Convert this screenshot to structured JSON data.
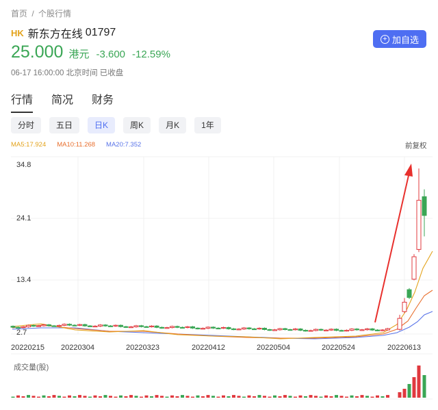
{
  "breadcrumb": {
    "home": "首页",
    "sep": "/",
    "current": "个股行情"
  },
  "stock": {
    "market": "HK",
    "name": "新东方在线",
    "code": "01797"
  },
  "quote": {
    "price": "25.000",
    "currency": "港元",
    "change": "-3.600",
    "change_pct": "-12.59%",
    "status": "06-17 16:00:00 北京时间 已收盘"
  },
  "watch_button": {
    "label": "加自选",
    "icon": "plus-circle-icon"
  },
  "main_tabs": [
    "行情",
    "简况",
    "财务"
  ],
  "period_tabs": [
    "分时",
    "五日",
    "日K",
    "周K",
    "月K",
    "1年"
  ],
  "active_period": "日K",
  "ma_legend": {
    "ma5": "MA5:17.924",
    "ma10": "MA10:11.268",
    "ma20": "MA20:7.352"
  },
  "adjust_label": "前复权",
  "volume_label": "成交量(股)",
  "colors": {
    "accent": "#4e6ef2",
    "down": "#3aa655",
    "up": "#e0383e",
    "ma5": "#e3a21a",
    "ma10": "#e86e2c",
    "ma20": "#5873e8",
    "annotation_arrow": "#e8302d"
  },
  "chart_data": {
    "type": "candlestick",
    "y_ticks": [
      "34.8",
      "24.1",
      "13.4",
      "2.7"
    ],
    "ylim": [
      2.7,
      34.8
    ],
    "x_ticks": [
      "20220215",
      "20220304",
      "20220323",
      "20220412",
      "20220504",
      "20220524",
      "20220613"
    ],
    "recent_candles": [
      {
        "open": 3.2,
        "close": 5.3,
        "high": 6.0,
        "low": 3.0,
        "dir": "up"
      },
      {
        "open": 6.6,
        "close": 8.4,
        "high": 9.2,
        "low": 6.3,
        "dir": "up"
      },
      {
        "open": 10.8,
        "close": 9.3,
        "high": 11.1,
        "low": 9.0,
        "dir": "down"
      },
      {
        "open": 12.8,
        "close": 17.1,
        "high": 17.6,
        "low": 12.6,
        "dir": "up"
      },
      {
        "open": 18.5,
        "close": 27.9,
        "high": 34.0,
        "low": 18.0,
        "dir": "up"
      },
      {
        "open": 28.6,
        "close": 25.0,
        "high": 30.0,
        "low": 21.0,
        "dir": "down"
      }
    ],
    "ma_last": {
      "ma5": 17.924,
      "ma10": 11.268,
      "ma20": 7.352
    },
    "grid": true
  }
}
